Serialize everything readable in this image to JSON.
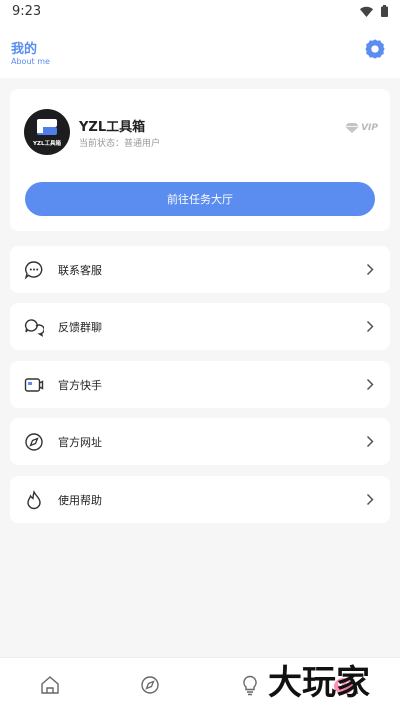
{
  "status_bar": {
    "time": "9:23"
  },
  "header": {
    "title": "我的",
    "subtitle": "About me"
  },
  "profile": {
    "avatar_caption": "YZL工具箱",
    "name": "YZL工具箱",
    "status": "当前状态：普通用户",
    "vip_label": "VIP",
    "task_button": "前往任务大厅"
  },
  "menu": [
    {
      "label": "联系客服",
      "icon": "chat-bubble-icon"
    },
    {
      "label": "反馈群聊",
      "icon": "group-chat-icon"
    },
    {
      "label": "官方快手",
      "icon": "video-card-icon"
    },
    {
      "label": "官方网址",
      "icon": "compass-icon"
    },
    {
      "label": "使用帮助",
      "icon": "flame-icon"
    }
  ],
  "bottom_nav": [
    "home-icon",
    "compass-icon",
    "lightbulb-icon",
    "user-icon"
  ],
  "watermark": {
    "text": "大玩家"
  },
  "colors": {
    "accent": "#5b8cf0",
    "background": "#f6f6f6"
  }
}
